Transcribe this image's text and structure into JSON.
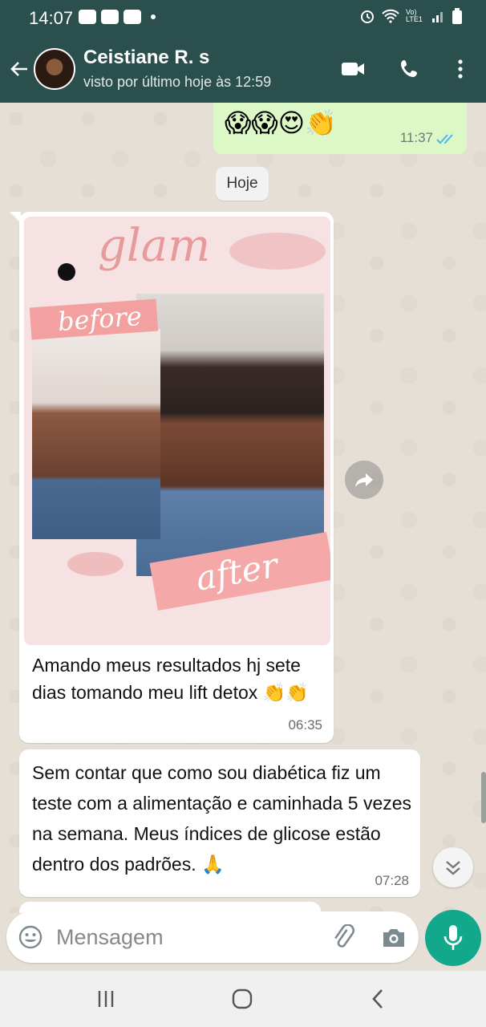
{
  "status_bar": {
    "time": "14:07",
    "network_label": "Vo) LTE1"
  },
  "header": {
    "contact_name": "Ceistiane R. s",
    "last_seen": "visto por último hoje às 12:59"
  },
  "messages": {
    "outgoing_top": {
      "emojis": "😱😱😍👏",
      "time": "11:37"
    },
    "date_chip": "Hoje",
    "photo": {
      "label_glam": "glam",
      "label_before": "before",
      "label_after": "after"
    },
    "incoming_1": {
      "caption": "Amando meus resultados hj sete dias tomando meu lift detox 👏👏",
      "time": "06:35"
    },
    "incoming_2": {
      "text": "Sem contar que como sou diabética fiz um teste com a alimentação e caminhada 5 vezes na semana. Meus índices de glicose estão dentro dos padrões. 🙏",
      "time": "07:28"
    }
  },
  "input": {
    "placeholder": "Mensagem"
  },
  "colors": {
    "header_bg": "#2a4f4c",
    "outgoing_bubble": "#dcf8c6",
    "mic_button": "#11a88c",
    "read_ticks": "#4fb6ec"
  }
}
